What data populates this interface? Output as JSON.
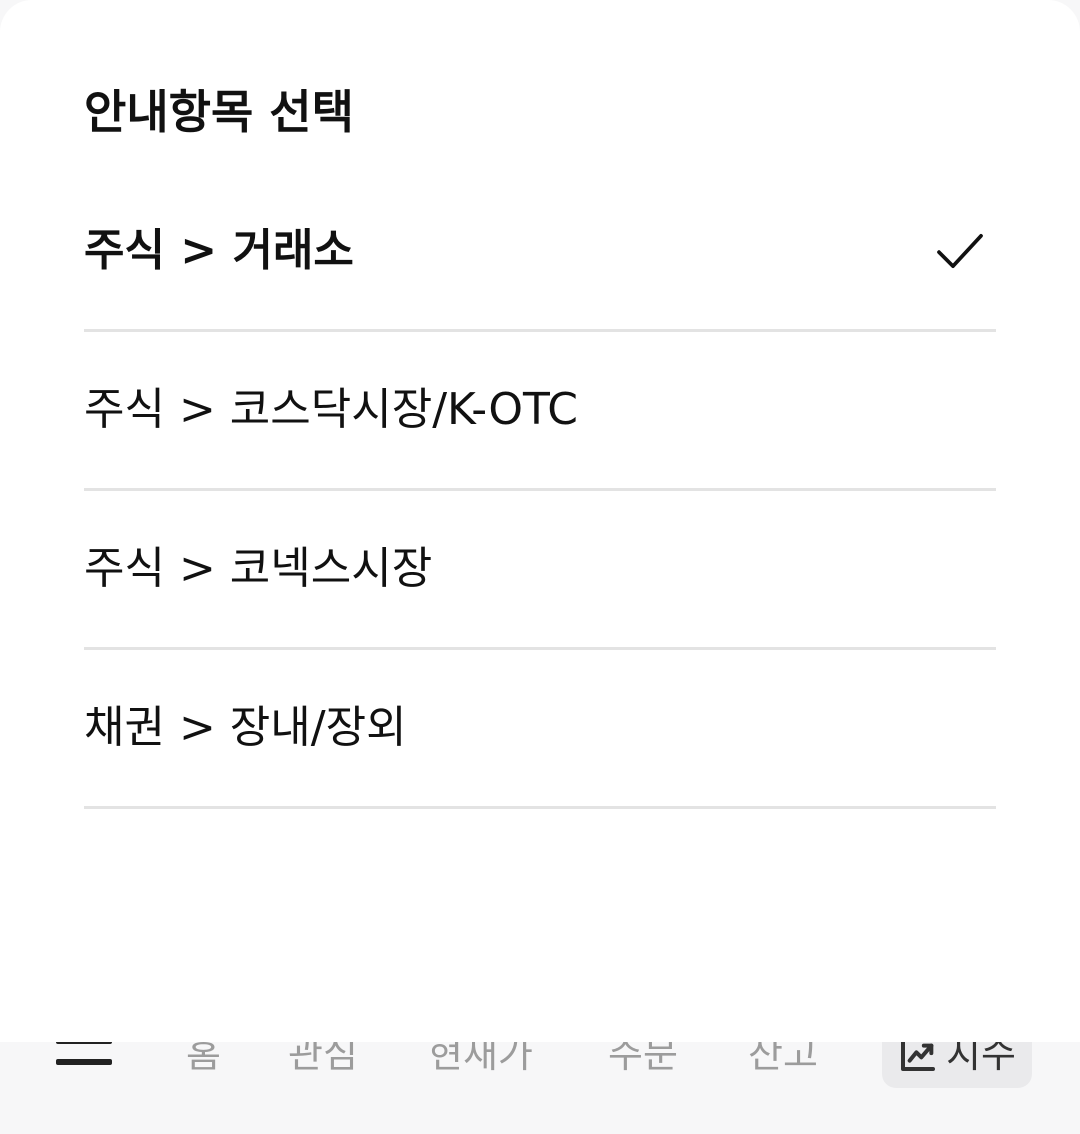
{
  "sheet": {
    "title": "안내항목 선택",
    "options": [
      {
        "label": "주식 > 거래소",
        "selected": true
      },
      {
        "label": "주식 > 코스닥시장/K-OTC",
        "selected": false
      },
      {
        "label": "주식 > 코넥스시장",
        "selected": false
      },
      {
        "label": "채권 > 장내/장외",
        "selected": false
      }
    ],
    "selected_icon": "check-icon"
  },
  "bottom_nav": {
    "menu_icon": "hamburger-menu-icon",
    "items": [
      "홈",
      "관심",
      "현재가",
      "주문",
      "잔고"
    ],
    "active": {
      "label": "지수",
      "icon": "trending-up-icon"
    }
  }
}
